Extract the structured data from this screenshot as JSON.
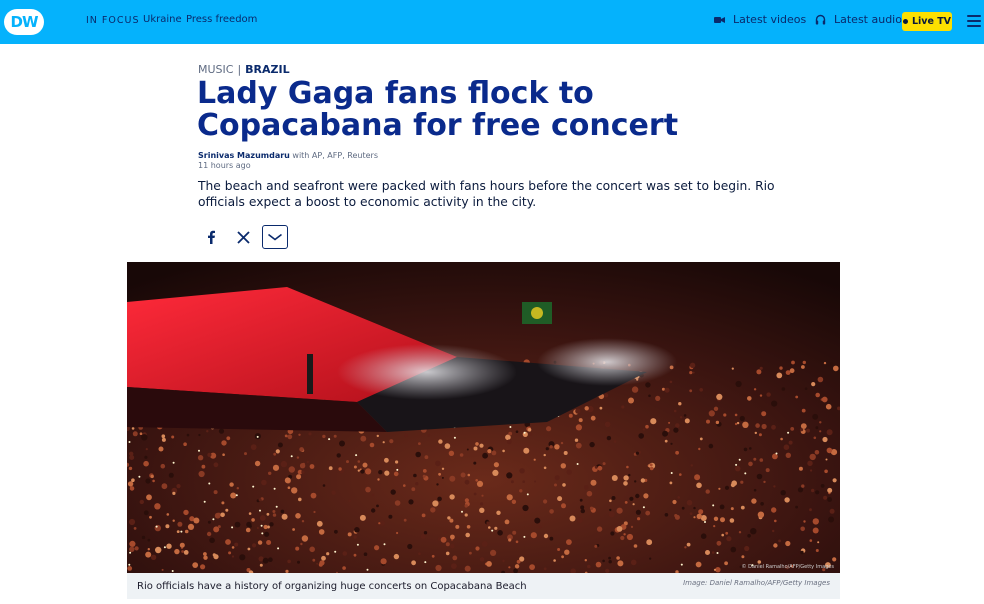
{
  "header": {
    "logo": "DW",
    "nav": {
      "in_focus": "IN FOCUS",
      "items": [
        "Ukraine",
        "Press freedom"
      ]
    },
    "latest_videos": "Latest videos",
    "latest_audio": "Latest audio",
    "live_tv": "Live TV",
    "icons": {
      "videos": "video-camera-icon",
      "audio": "headphones-icon",
      "live": "live-dot-icon",
      "menu": "hamburger-menu-icon"
    },
    "colors": {
      "bar": "#05b2fc",
      "live": "#fde000",
      "text": "#0a2a6c"
    }
  },
  "article": {
    "section": "MUSIC",
    "subsection": "BRAZIL",
    "title": "Lady Gaga fans flock to Copacabana for free concert",
    "author": "Srinivas Mazumdaru",
    "agencies": "with AP, AFP, Reuters",
    "time_ago": "11 hours ago",
    "teaser": "The beach and seafront were packed with fans hours before the concert was set to begin. Rio officials expect a boost to economic activity in the city.",
    "share": {
      "facebook_icon": "facebook-icon",
      "x_icon": "x-icon",
      "more_icon": "chevron-down-icon"
    }
  },
  "image": {
    "overlay_credit": "© Daniel Ramalho/AFP/Getty Images",
    "caption": "Rio officials have a history of organizing huge concerts on Copacabana Beach",
    "credit": "Image: Daniel Ramalho/AFP/Getty Images"
  }
}
